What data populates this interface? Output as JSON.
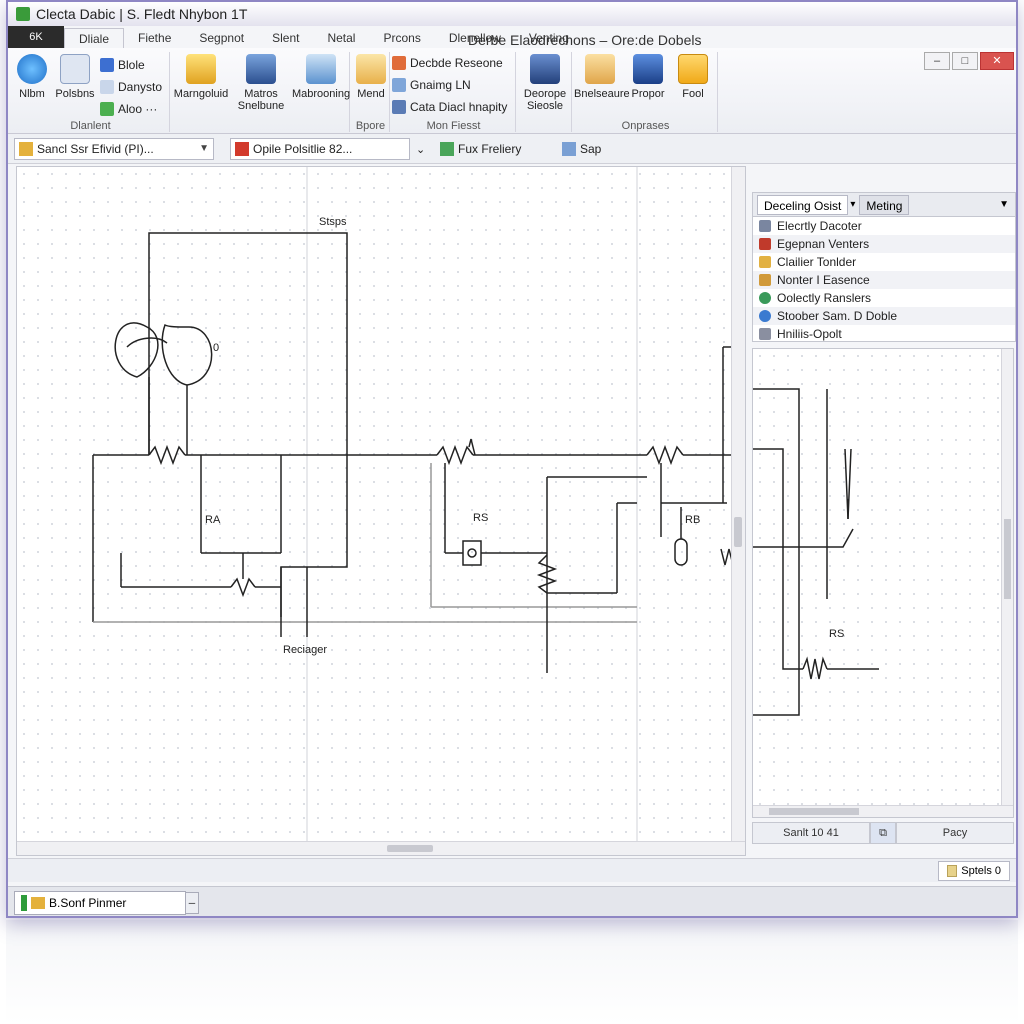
{
  "window": {
    "title": "Clecta Dabic | S. Fledt Nhybon 1T",
    "document_title": "Derbe Elaodrechons – Ore:de Dobels",
    "buttons": {
      "minimize": "–",
      "maximize": "□",
      "close": "✕"
    }
  },
  "tabs": {
    "file": "6K",
    "items": [
      "Dliale",
      "Fiethe",
      "Segpnot",
      "Slent",
      "Netal",
      "Prcons",
      "Dlenellow",
      "Venting"
    ],
    "active_index": 0
  },
  "ribbon": {
    "groups": [
      {
        "label": "Dlanlent",
        "big_buttons": [
          "Nlbm",
          "Polsbns"
        ],
        "small_buttons": [
          "Blole",
          "Danysto",
          "Aloo ···"
        ]
      },
      {
        "label": "",
        "big_buttons": [
          "Marngoluid",
          "Matros Snelbune",
          "Mabrooning"
        ]
      },
      {
        "label": "Bpore",
        "big_buttons": [
          "Mend"
        ]
      },
      {
        "label": "Mon Fiesst",
        "small_buttons": [
          "Decbde Reseone",
          "Gnaimg LN",
          "Cata Diacl hnapity"
        ]
      },
      {
        "label": "",
        "big_buttons": [
          "Deorope Sieosle"
        ]
      },
      {
        "label": "Onprases",
        "big_buttons": [
          "Bnelseaure",
          "Propor",
          "Fool"
        ]
      }
    ]
  },
  "address_bar": {
    "combo1": "Sancl Ssr Efivid (PI)...",
    "combo2": "Opile Polsitlie 82...",
    "items": [
      "Fux Freliery",
      "Sap"
    ]
  },
  "schematic": {
    "labels": {
      "top": "Stsps",
      "ra": "RA",
      "rb": "RB",
      "r5": "RS",
      "bottom": "Reciager",
      "d0": "0",
      "side": "RS"
    }
  },
  "side_panel": {
    "tabs": [
      "Deceling Osist",
      "Meting"
    ],
    "items": [
      "Elecrtly Dacoter",
      "Egepnan Venters",
      "Clailier Tonlder",
      "Nonter I Easence",
      "Oolectly Ranslers",
      "Stoober Sam. D Doble",
      "Hniliis-Opolt"
    ]
  },
  "panel_status": {
    "left": "Sanlt 10 41",
    "right": "Pacy"
  },
  "status_bar": {
    "right": "Sptels 0"
  },
  "taskbar": {
    "item": "B.Sonf Pinmer"
  }
}
